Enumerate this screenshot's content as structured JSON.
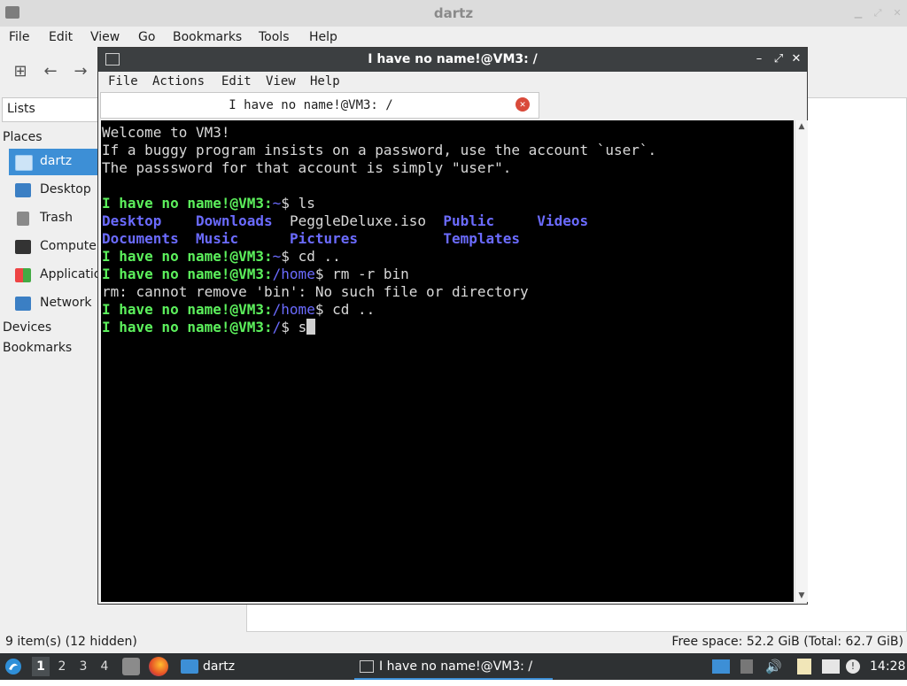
{
  "file_manager": {
    "title": "dartz",
    "menu": [
      "File",
      "Edit",
      "View",
      "Go",
      "Bookmarks",
      "Tools",
      "Help"
    ],
    "lists_label": "Lists",
    "places_header": "Places",
    "places": [
      {
        "label": "dartz",
        "icon": "home-folder-icon",
        "selected": true
      },
      {
        "label": "Desktop",
        "icon": "desktop-icon",
        "selected": false
      },
      {
        "label": "Trash",
        "icon": "trash-icon",
        "selected": false
      },
      {
        "label": "Computer",
        "icon": "computer-icon",
        "selected": false
      },
      {
        "label": "Applications",
        "icon": "applications-icon",
        "selected": false
      },
      {
        "label": "Network",
        "icon": "network-icon",
        "selected": false
      }
    ],
    "devices_header": "Devices",
    "bookmarks_header": "Bookmarks",
    "status_left": "9 item(s) (12 hidden)",
    "status_right": "Free space: 52.2 GiB (Total: 62.7 GiB)"
  },
  "terminal": {
    "title": "I have no name!@VM3: /",
    "menu": [
      "File",
      "Actions",
      "Edit",
      "View",
      "Help"
    ],
    "tab_label": "I have no name!@VM3: /",
    "colors": {
      "background": "#000000",
      "text": "#d9d9d9",
      "prompt": "#5cf05c",
      "path": "#6b6bff"
    },
    "lines": {
      "welcome1": "Welcome to VM3!",
      "welcome2": "If a buggy program insists on a password, use the account `user`.",
      "welcome3": "The passsword for that account is simply \"user\".",
      "prompt_user": "I have no name!@VM3:",
      "p1_path": "~",
      "p1_cmd": "$ ls",
      "ls_row1": {
        "c1": "Desktop",
        "c2": "Downloads",
        "c3": "PeggleDeluxe.iso",
        "c4": "Public",
        "c5": "Videos"
      },
      "ls_row2": {
        "c1": "Documents",
        "c2": "Music",
        "c3": "Pictures",
        "c4": "Templates"
      },
      "p2_path": "~",
      "p2_cmd": "$ cd ..",
      "p3_path": "/home",
      "p3_cmd": "$ rm -r bin",
      "error": "rm: cannot remove 'bin': No such file or directory",
      "p4_path": "/home",
      "p4_cmd": "$ cd ..",
      "p5_path": "/",
      "p5_cmd": "$ s"
    }
  },
  "taskbar": {
    "workspaces": [
      "1",
      "2",
      "3",
      "4"
    ],
    "active_workspace": "1",
    "tasks": [
      {
        "label": "dartz",
        "icon": "folder-icon"
      },
      {
        "label": "I have no name!@VM3: /",
        "icon": "terminal-icon"
      }
    ],
    "clock": "14:28"
  }
}
